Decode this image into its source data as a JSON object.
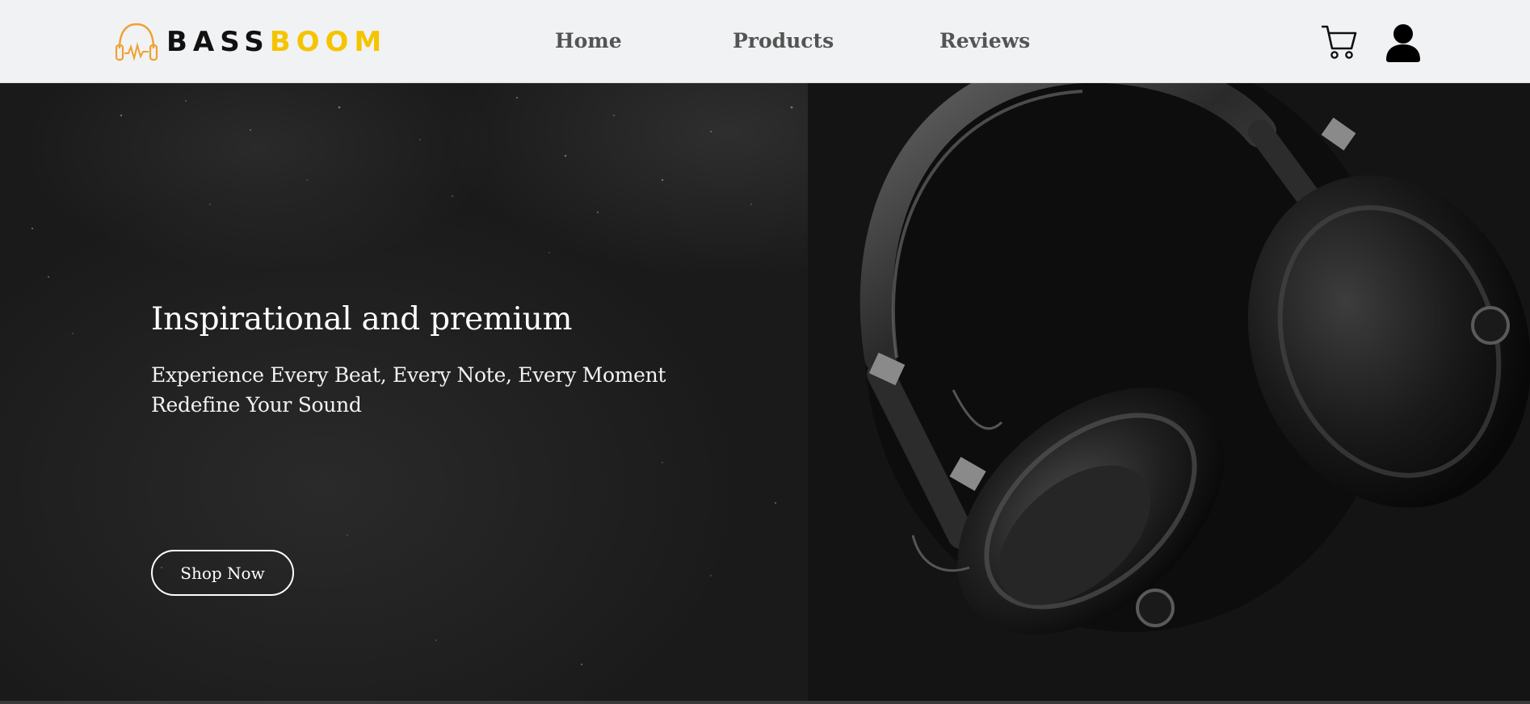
{
  "brand": {
    "name_part1": "BASS",
    "name_part2": "BOOM",
    "accent_color": "#f5c400",
    "icon": "headphones-pulse-icon"
  },
  "nav": {
    "links": [
      {
        "label": "Home"
      },
      {
        "label": "Products"
      },
      {
        "label": "Reviews"
      }
    ],
    "actions": [
      {
        "icon": "shopping-cart-icon"
      },
      {
        "icon": "user-account-icon"
      }
    ]
  },
  "hero": {
    "title": "Inspirational and premium",
    "subtitle_line1": "Experience Every Beat, Every Note, Every Moment",
    "subtitle_line2": "Redefine Your Sound",
    "cta_label": "Shop Now",
    "image": "black-headphones-on-dark-surface"
  },
  "colors": {
    "navbar_bg": "#f1f2f4",
    "nav_text": "#545454",
    "hero_bg": "#1b1b1b",
    "hero_text": "#ffffff"
  }
}
